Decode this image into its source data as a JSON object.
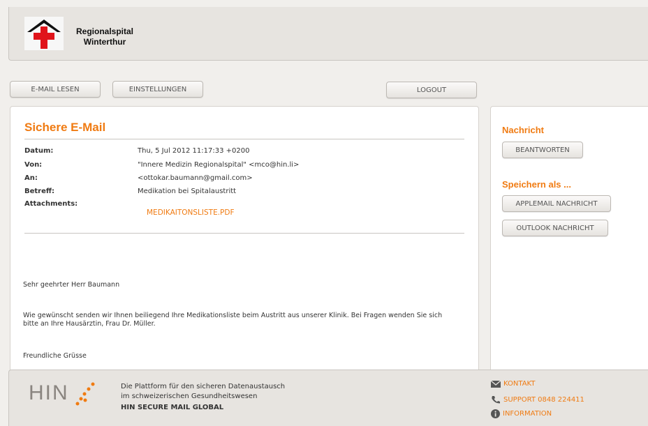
{
  "header": {
    "hospital_name_line1": "Regionalspital",
    "hospital_name_line2": "Winterthur"
  },
  "nav": {
    "read_email": "E-MAIL LESEN",
    "settings": "EINSTELLUNGEN",
    "logout": "LOGOUT"
  },
  "email": {
    "title": "Sichere E-Mail",
    "labels": {
      "date": "Datum:",
      "from": "Von:",
      "to": "An:",
      "subject": "Betreff:",
      "attachments": "Attachments:"
    },
    "date": "Thu, 5 Jul 2012 11:17:33 +0200",
    "from": "\"Innere Medizin Regionalspital\" <mco@hin.li>",
    "to": "<ottokar.baumann@gmail.com>",
    "subject": "Medikation bei Spitalaustritt",
    "attachment_name": "MEDIKAITONSLISTE.PDF",
    "salutation": "Sehr geehrter Herr Baumann",
    "body_line1": "Wie gewünscht senden wir Ihnen beiliegend Ihre Medikationsliste beim Austritt aus unserer Klinik. Bei Fragen wenden Sie sich",
    "body_line2": "bitte an Ihre Hausärztin, Frau Dr. Müller.",
    "closing": "Freundliche Grüsse"
  },
  "sidebar": {
    "message_heading": "Nachricht",
    "reply_button": "BEANTWORTEN",
    "save_as_heading": "Speichern als ...",
    "applemail_button": "APPLEMAIL NACHRICHT",
    "outlook_button": "OUTLOOK NACHRICHT"
  },
  "footer": {
    "brand": "HIN",
    "tagline_line1": "Die Plattform für den sicheren Datenaustausch",
    "tagline_line2": "im schweizerischen Gesundheitswesen",
    "product_name": "HIN SECURE MAIL GLOBAL",
    "contact": "KONTAKT",
    "support": "SUPPORT 0848 224411",
    "information": "INFORMATION"
  },
  "colors": {
    "accent": "#f07b12",
    "logo_red": "#e0141b",
    "background": "#f1efec"
  },
  "icons": [
    "hospital-logo-icon",
    "envelope-icon",
    "phone-icon",
    "info-icon"
  ]
}
